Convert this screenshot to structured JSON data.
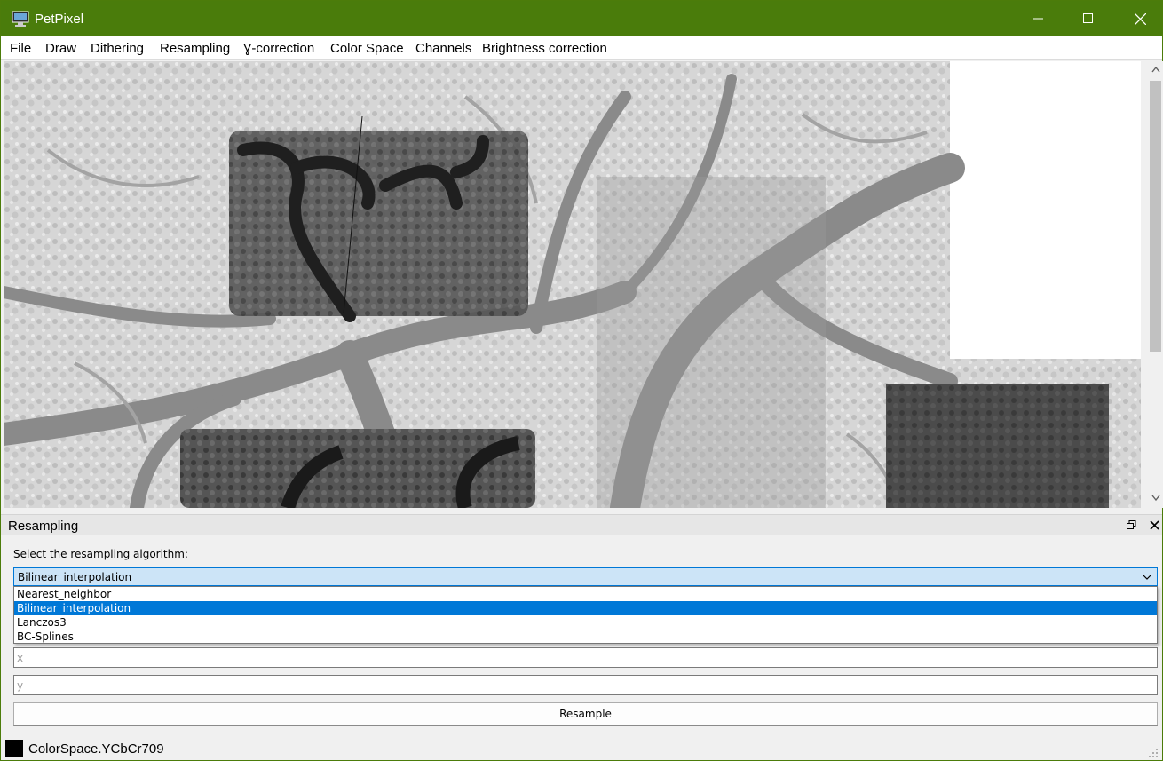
{
  "window": {
    "title": "PetPixel"
  },
  "menu": [
    "File",
    "Draw",
    "Dithering",
    "Resampling",
    "Ɣ-correction",
    "Color Space",
    "Channels",
    "Brightness correction"
  ],
  "dock": {
    "title": "Resampling",
    "select_label": "Select the resampling algorithm:",
    "selected": "Bilinear_interpolation",
    "options": [
      "Nearest_neighbor",
      "Bilinear_interpolation",
      "Lanczos3",
      "BC-Splines"
    ],
    "x_placeholder": "x",
    "y_placeholder": "y",
    "resample_label": "Resample"
  },
  "status": {
    "text": "ColorSpace.YCbCr709",
    "swatch_color": "#000000"
  },
  "colors": {
    "titlebar": "#4a7c0b",
    "selection": "#0078d7",
    "combo_bg": "#cce4f7"
  },
  "icons": [
    "app-icon",
    "minimize-icon",
    "maximize-icon",
    "close-icon",
    "scroll-up-icon",
    "scroll-down-icon",
    "float-icon",
    "dock-close-icon",
    "chevron-down-icon",
    "size-grip-icon"
  ]
}
